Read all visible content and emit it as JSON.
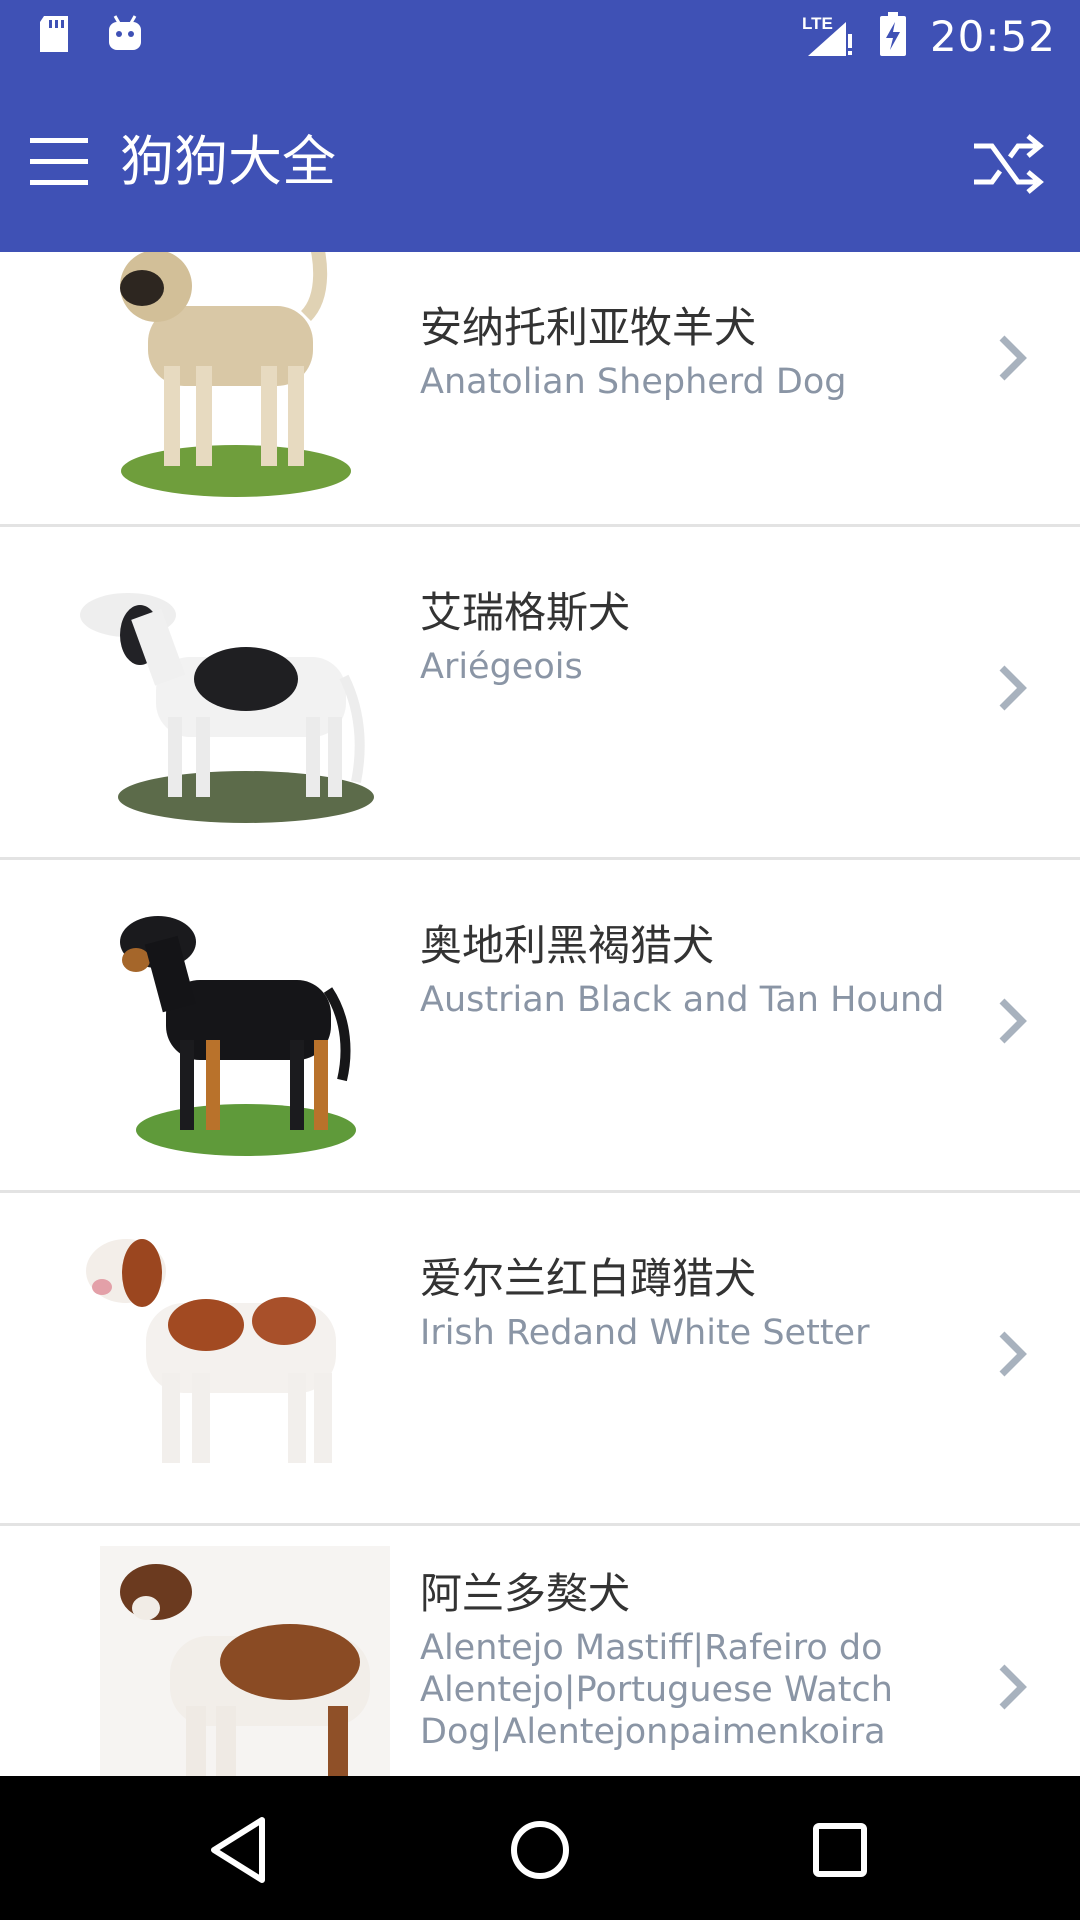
{
  "status_bar": {
    "time": "20:52",
    "network": "LTE",
    "icons": [
      "sd-card-icon",
      "android-icon",
      "signal-icon",
      "battery-icon"
    ]
  },
  "app_bar": {
    "title": "狗狗大全",
    "menu_icon": "hamburger-menu-icon",
    "action_icon": "shuffle-icon"
  },
  "items": [
    {
      "name_zh": "安纳托利亚牧羊犬",
      "name_en": "Anatolian Shepherd Dog"
    },
    {
      "name_zh": "艾瑞格斯犬",
      "name_en": "Ariégeois"
    },
    {
      "name_zh": "奥地利黑褐猎犬",
      "name_en": "Austrian Black and Tan Hound"
    },
    {
      "name_zh": "爱尔兰红白蹲猎犬",
      "name_en": "Irish Redand White Setter"
    },
    {
      "name_zh": "阿兰多獒犬",
      "name_en": "Alentejo Mastiff|Rafeiro do Alentejo|Portuguese Watch Dog|Alentejonpaimenkoira"
    }
  ],
  "nav_bar": {
    "back_icon": "back-triangle-icon",
    "home_icon": "home-circle-icon",
    "recents_icon": "recents-square-icon"
  },
  "colors": {
    "primary": "#3F51B5",
    "title_text": "#333333",
    "subtitle_text": "#8A95A5",
    "divider": "#E3E3E3"
  }
}
